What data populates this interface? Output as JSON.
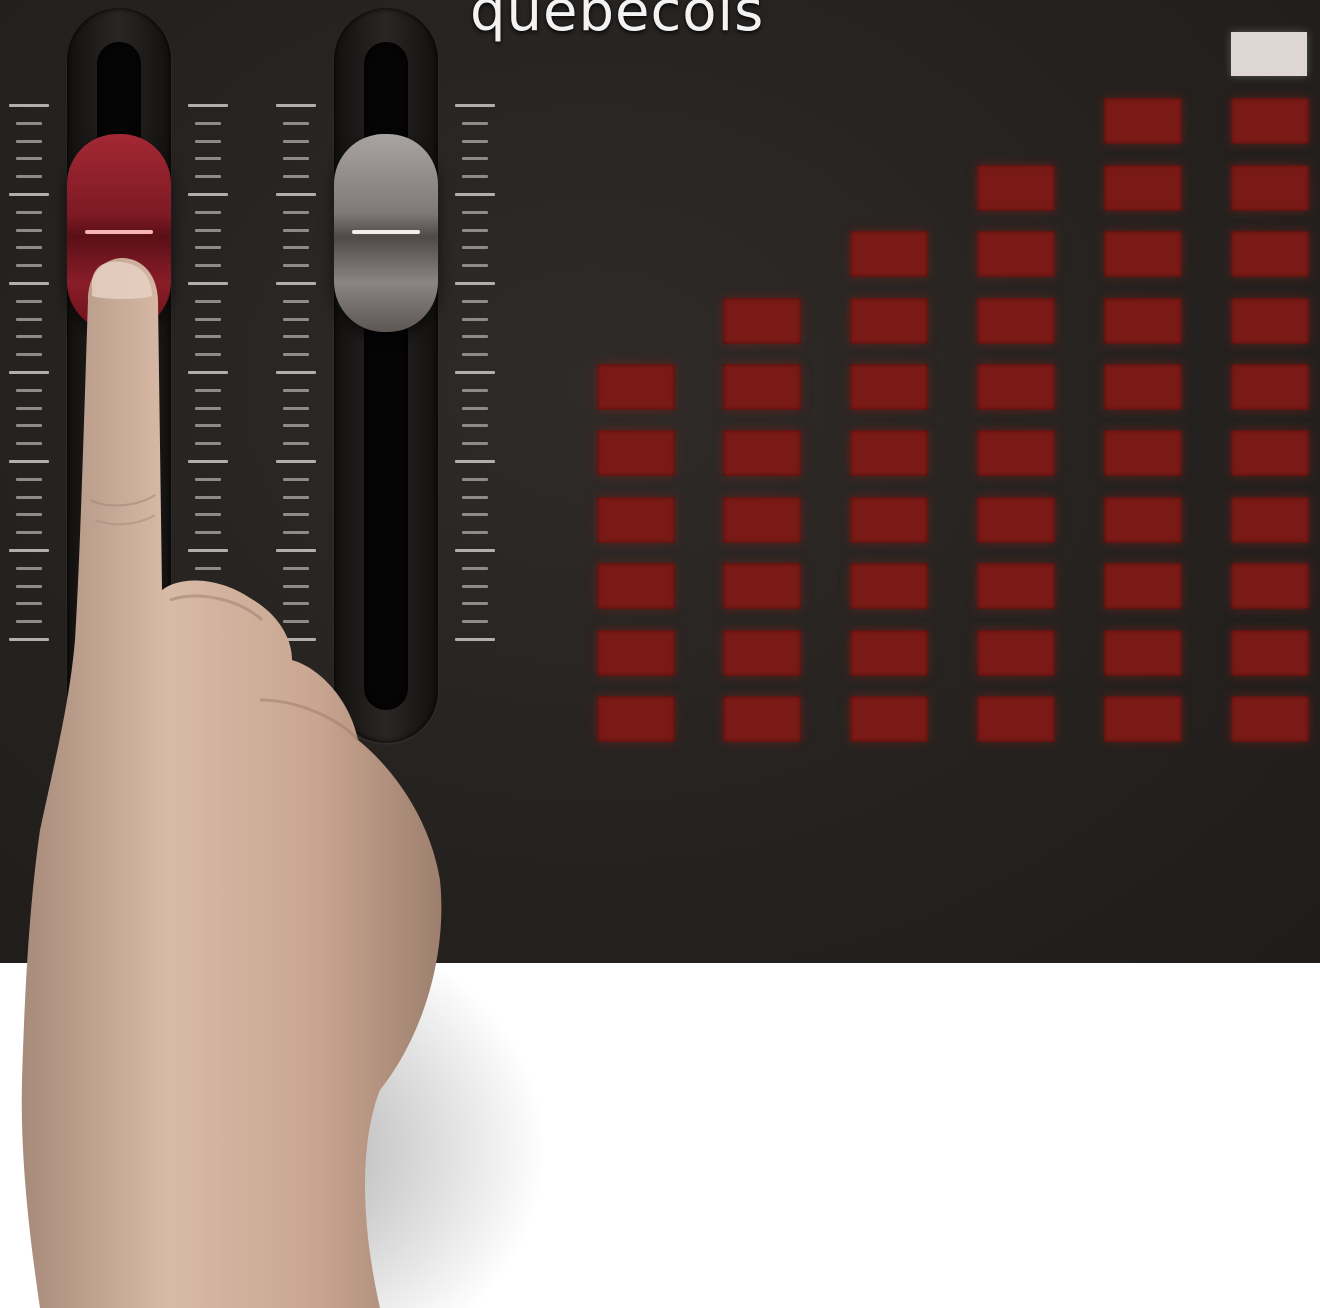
{
  "title": "quebecois",
  "faders": [
    {
      "name": "fader-1",
      "knob_color": "#8a1c26",
      "level": 0.83
    },
    {
      "name": "fader-2",
      "knob_color": "#8a8482",
      "level": 0.83
    }
  ],
  "meter": {
    "cell_color": "#7a1a16",
    "indicator_color": "#ded6d2",
    "column_levels": [
      6,
      7,
      8,
      9,
      10,
      10
    ]
  },
  "icons": [
    "hand-pointer-icon"
  ]
}
